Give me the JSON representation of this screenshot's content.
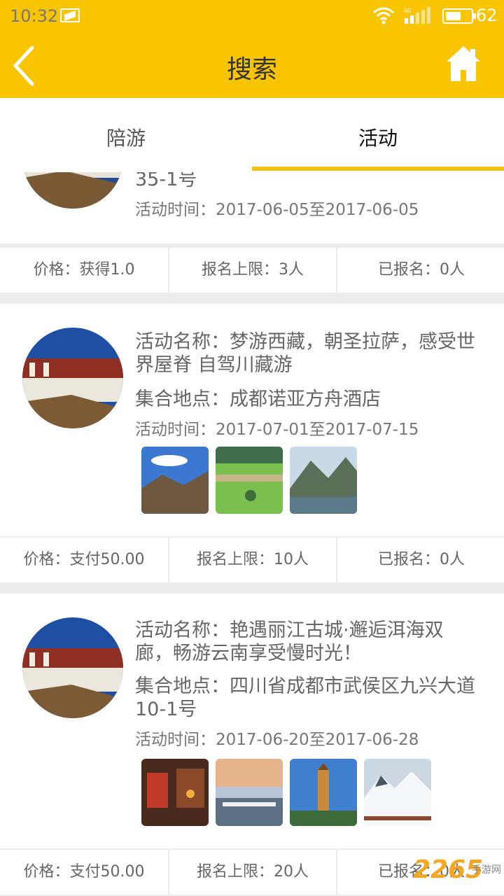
{
  "status_bar": {
    "time": "10:32",
    "battery_percent": "62",
    "battery_level": 0.62
  },
  "nav": {
    "title": "搜索",
    "back_icon": "chevron-left-icon",
    "home_icon": "home-icon"
  },
  "tabs": [
    {
      "label": "陪游",
      "selected": false
    },
    {
      "label": "活动",
      "selected": true
    }
  ],
  "activities": [
    {
      "place_tail": "35-1号",
      "time": "活动时间：2017-06-05至2017-06-05",
      "price": "价格：获得1.0",
      "limit": "报名上限：3人",
      "enrolled": "已报名：0人"
    },
    {
      "name": "活动名称：梦游西藏，朝圣拉萨，感受世界屋脊 自驾川藏游",
      "place": "集合地点：成都诺亚方舟酒店",
      "time": "活动时间：2017-07-01至2017-07-15",
      "images": [
        "mountain-sky",
        "valley-village",
        "lake-mountain"
      ],
      "price": "价格：支付50.00",
      "limit": "报名上限：10人",
      "enrolled": "已报名：0人"
    },
    {
      "name": "活动名称：艳遇丽江古城·邂逅洱海双廊，畅游云南享受慢时光！",
      "place": "集合地点：四川省成都市武侯区九兴大道10-1号",
      "time": "活动时间：2017-06-20至2017-06-28",
      "images": [
        "old-town-street",
        "lakeside-pier",
        "pagoda",
        "snow-mountain"
      ],
      "price": "价格：支付50.00",
      "limit": "报名上限：20人",
      "enrolled": "已报名：0人"
    }
  ],
  "colors": {
    "accent": "#f9c500",
    "tab_indicator": "#f0c419",
    "divider": "#ececec"
  },
  "watermark": {
    "brand": "2265",
    "sub": "手游网"
  }
}
